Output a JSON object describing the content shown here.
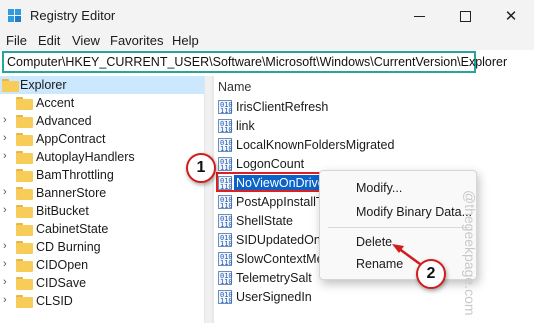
{
  "window": {
    "title": "Registry Editor"
  },
  "menu": [
    "File",
    "Edit",
    "View",
    "Favorites",
    "Help"
  ],
  "address": "Computer\\HKEY_CURRENT_USER\\Software\\Microsoft\\Windows\\CurrentVersion\\Explorer",
  "tree": {
    "selected": "Explorer",
    "children": [
      "Accent",
      "Advanced",
      "AppContract",
      "AutoplayHandlers",
      "BamThrottling",
      "BannerStore",
      "BitBucket",
      "CabinetState",
      "CD Burning",
      "CIDOpen",
      "CIDSave",
      "CLSID"
    ]
  },
  "values_pane": {
    "column_header": "Name",
    "rows": [
      "IrisClientRefresh",
      "link",
      "LocalKnownFoldersMigrated",
      "LogonCount",
      "NoViewOnDrive",
      "PostAppInstallTa",
      "ShellState",
      "SIDUpdatedOnL",
      "SlowContextMe",
      "TelemetrySalt",
      "UserSignedIn"
    ],
    "selected": "NoViewOnDrive"
  },
  "context_menu": {
    "items": [
      "Modify...",
      "Modify Binary Data...",
      "Delete",
      "Rename"
    ]
  },
  "callouts": [
    "1",
    "2"
  ],
  "watermark": "@thegeekpage.com",
  "colors": {
    "address_border": "#26a69a",
    "selection": "#0a63c9",
    "callout_border": "#d01d1d",
    "highlight_box": "#e02020"
  }
}
